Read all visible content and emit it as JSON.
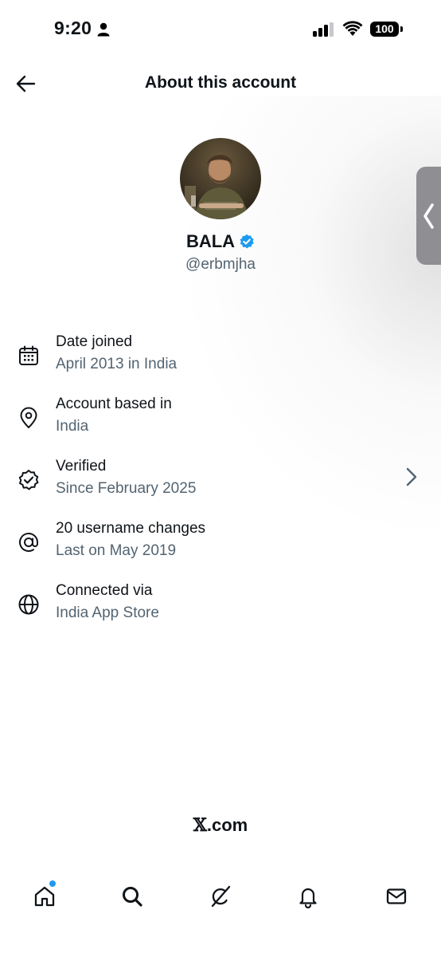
{
  "status_bar": {
    "time": "9:20",
    "battery": "100"
  },
  "header": {
    "title": "About this account"
  },
  "profile": {
    "name": "BALA",
    "handle": "@erbmjha"
  },
  "info": [
    {
      "icon": "calendar-icon",
      "title": "Date joined",
      "subtitle": "April 2013 in India"
    },
    {
      "icon": "location-pin-icon",
      "title": "Account based in",
      "subtitle": "India"
    },
    {
      "icon": "verified-badge-icon",
      "title": "Verified",
      "subtitle": "Since February 2025"
    },
    {
      "icon": "at-sign-icon",
      "title": "20 username changes",
      "subtitle": "Last on May 2019"
    },
    {
      "icon": "globe-icon",
      "title": "Connected via",
      "subtitle": "India App Store"
    }
  ],
  "footer": {
    "brand_x": "𝕏",
    "brand_suffix": ".com"
  },
  "colors": {
    "accent": "#1d9bf0",
    "text": "#0f1419",
    "secondary": "#536471"
  }
}
